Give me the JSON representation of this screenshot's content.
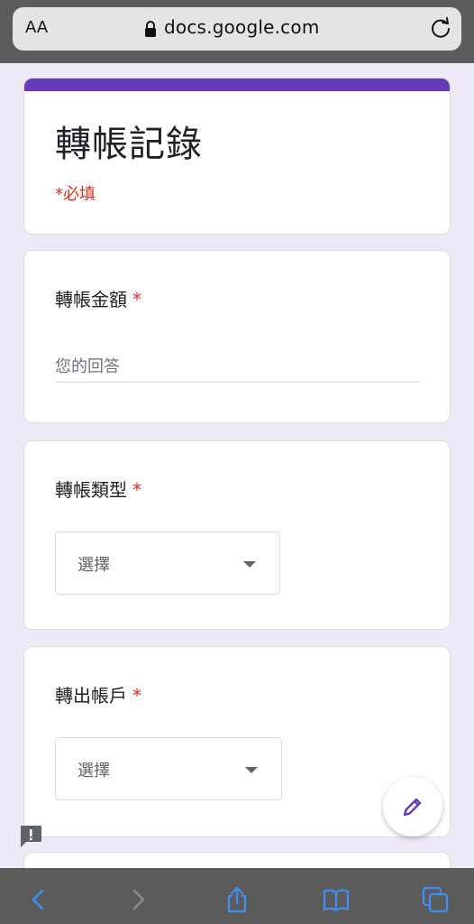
{
  "browser": {
    "text_size_label": "AA",
    "url": "docs.google.com"
  },
  "form": {
    "title": "轉帳記錄",
    "required_note": "*必填",
    "accent_color": "#673ab7",
    "questions": [
      {
        "label": "轉帳金額",
        "required_marker": "*",
        "type": "short-answer",
        "placeholder": "您的回答"
      },
      {
        "label": "轉帳類型",
        "required_marker": "*",
        "type": "dropdown",
        "selected": "選擇"
      },
      {
        "label": "轉出帳戶",
        "required_marker": "*",
        "type": "dropdown",
        "selected": "選擇"
      }
    ]
  },
  "icons": {
    "edit": "pencil-icon",
    "report": "report-problem-icon",
    "lock": "lock-icon",
    "reload": "reload-icon",
    "toolbar": [
      "back-icon",
      "forward-icon",
      "share-icon",
      "bookmarks-icon",
      "tabs-icon"
    ]
  }
}
